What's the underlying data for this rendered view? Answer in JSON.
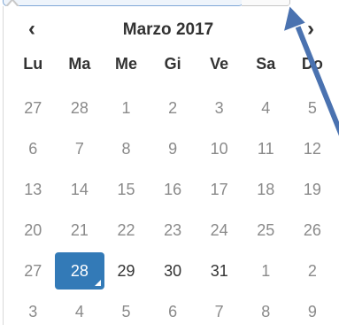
{
  "header": {
    "title": "Marzo 2017",
    "prev_glyph": "‹",
    "next_glyph": "›"
  },
  "weekdays": [
    "Lu",
    "Ma",
    "Me",
    "Gi",
    "Ve",
    "Sa",
    "Do"
  ],
  "weeks": [
    [
      {
        "d": "27",
        "cur": false
      },
      {
        "d": "28",
        "cur": false
      },
      {
        "d": "1",
        "cur": false
      },
      {
        "d": "2",
        "cur": false
      },
      {
        "d": "3",
        "cur": false
      },
      {
        "d": "4",
        "cur": false
      },
      {
        "d": "5",
        "cur": false
      }
    ],
    [
      {
        "d": "6",
        "cur": false
      },
      {
        "d": "7",
        "cur": false
      },
      {
        "d": "8",
        "cur": false
      },
      {
        "d": "9",
        "cur": false
      },
      {
        "d": "10",
        "cur": false
      },
      {
        "d": "11",
        "cur": false
      },
      {
        "d": "12",
        "cur": false
      }
    ],
    [
      {
        "d": "13",
        "cur": false
      },
      {
        "d": "14",
        "cur": false
      },
      {
        "d": "15",
        "cur": false
      },
      {
        "d": "16",
        "cur": false
      },
      {
        "d": "17",
        "cur": false
      },
      {
        "d": "18",
        "cur": false
      },
      {
        "d": "19",
        "cur": false
      }
    ],
    [
      {
        "d": "20",
        "cur": false
      },
      {
        "d": "21",
        "cur": false
      },
      {
        "d": "22",
        "cur": false
      },
      {
        "d": "23",
        "cur": false
      },
      {
        "d": "24",
        "cur": false
      },
      {
        "d": "25",
        "cur": false
      },
      {
        "d": "26",
        "cur": false
      }
    ],
    [
      {
        "d": "27",
        "cur": false
      },
      {
        "d": "28",
        "cur": true,
        "active": true
      },
      {
        "d": "29",
        "cur": true
      },
      {
        "d": "30",
        "cur": true
      },
      {
        "d": "31",
        "cur": true
      },
      {
        "d": "1",
        "cur": false
      },
      {
        "d": "2",
        "cur": false
      }
    ],
    [
      {
        "d": "3",
        "cur": false
      },
      {
        "d": "4",
        "cur": false
      },
      {
        "d": "5",
        "cur": false
      },
      {
        "d": "6",
        "cur": false
      },
      {
        "d": "7",
        "cur": false
      },
      {
        "d": "8",
        "cur": false
      },
      {
        "d": "9",
        "cur": false
      }
    ]
  ],
  "colors": {
    "active_bg": "#337ab7",
    "annotation_arrow": "#4a72b0",
    "muted_day": "#8a8a8a",
    "current_day": "#333333"
  }
}
